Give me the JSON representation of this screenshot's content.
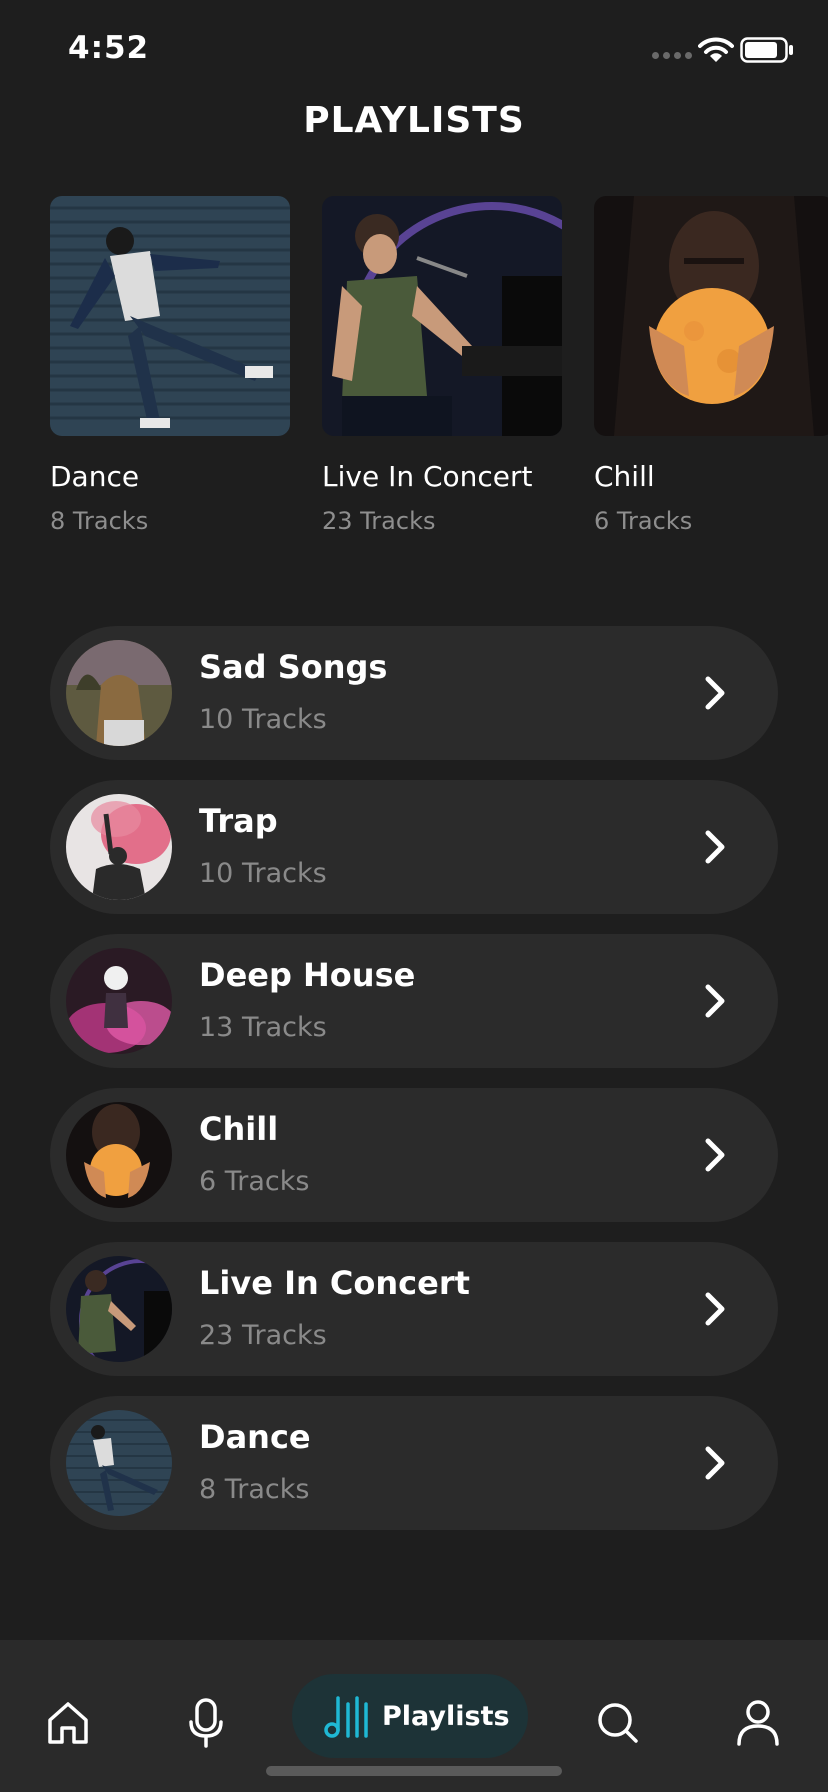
{
  "status_bar": {
    "time": "4:52"
  },
  "page": {
    "title": "PLAYLISTS"
  },
  "featured": [
    {
      "name": "Dance",
      "tracks": "8 Tracks",
      "image": "dance-photo"
    },
    {
      "name": "Live In Concert",
      "tracks": "23 Tracks",
      "image": "concert-photo"
    },
    {
      "name": "Chill",
      "tracks": "6 Tracks",
      "image": "chill-photo"
    }
  ],
  "playlists": [
    {
      "name": "Sad Songs",
      "tracks": "10 Tracks",
      "image": "sad-photo"
    },
    {
      "name": "Trap",
      "tracks": "10 Tracks",
      "image": "trap-photo"
    },
    {
      "name": "Deep House",
      "tracks": "13 Tracks",
      "image": "deephouse-photo"
    },
    {
      "name": "Chill",
      "tracks": "6 Tracks",
      "image": "chill-photo"
    },
    {
      "name": "Live In Concert",
      "tracks": "23 Tracks",
      "image": "concert-photo"
    },
    {
      "name": "Dance",
      "tracks": "8 Tracks",
      "image": "dance-photo"
    }
  ],
  "nav": {
    "home_icon": "home-icon",
    "mic_icon": "microphone-icon",
    "playlists_label": "Playlists",
    "playlists_icon": "music-bars-icon",
    "search_icon": "search-icon",
    "profile_icon": "profile-icon"
  },
  "colors": {
    "background": "#1e1e1e",
    "row": "#2b2b2b",
    "nav_bar": "#2a2a2a",
    "active_pill": "#1d3337",
    "accent": "#1fb8d4",
    "muted_text": "#8a8a8a"
  }
}
